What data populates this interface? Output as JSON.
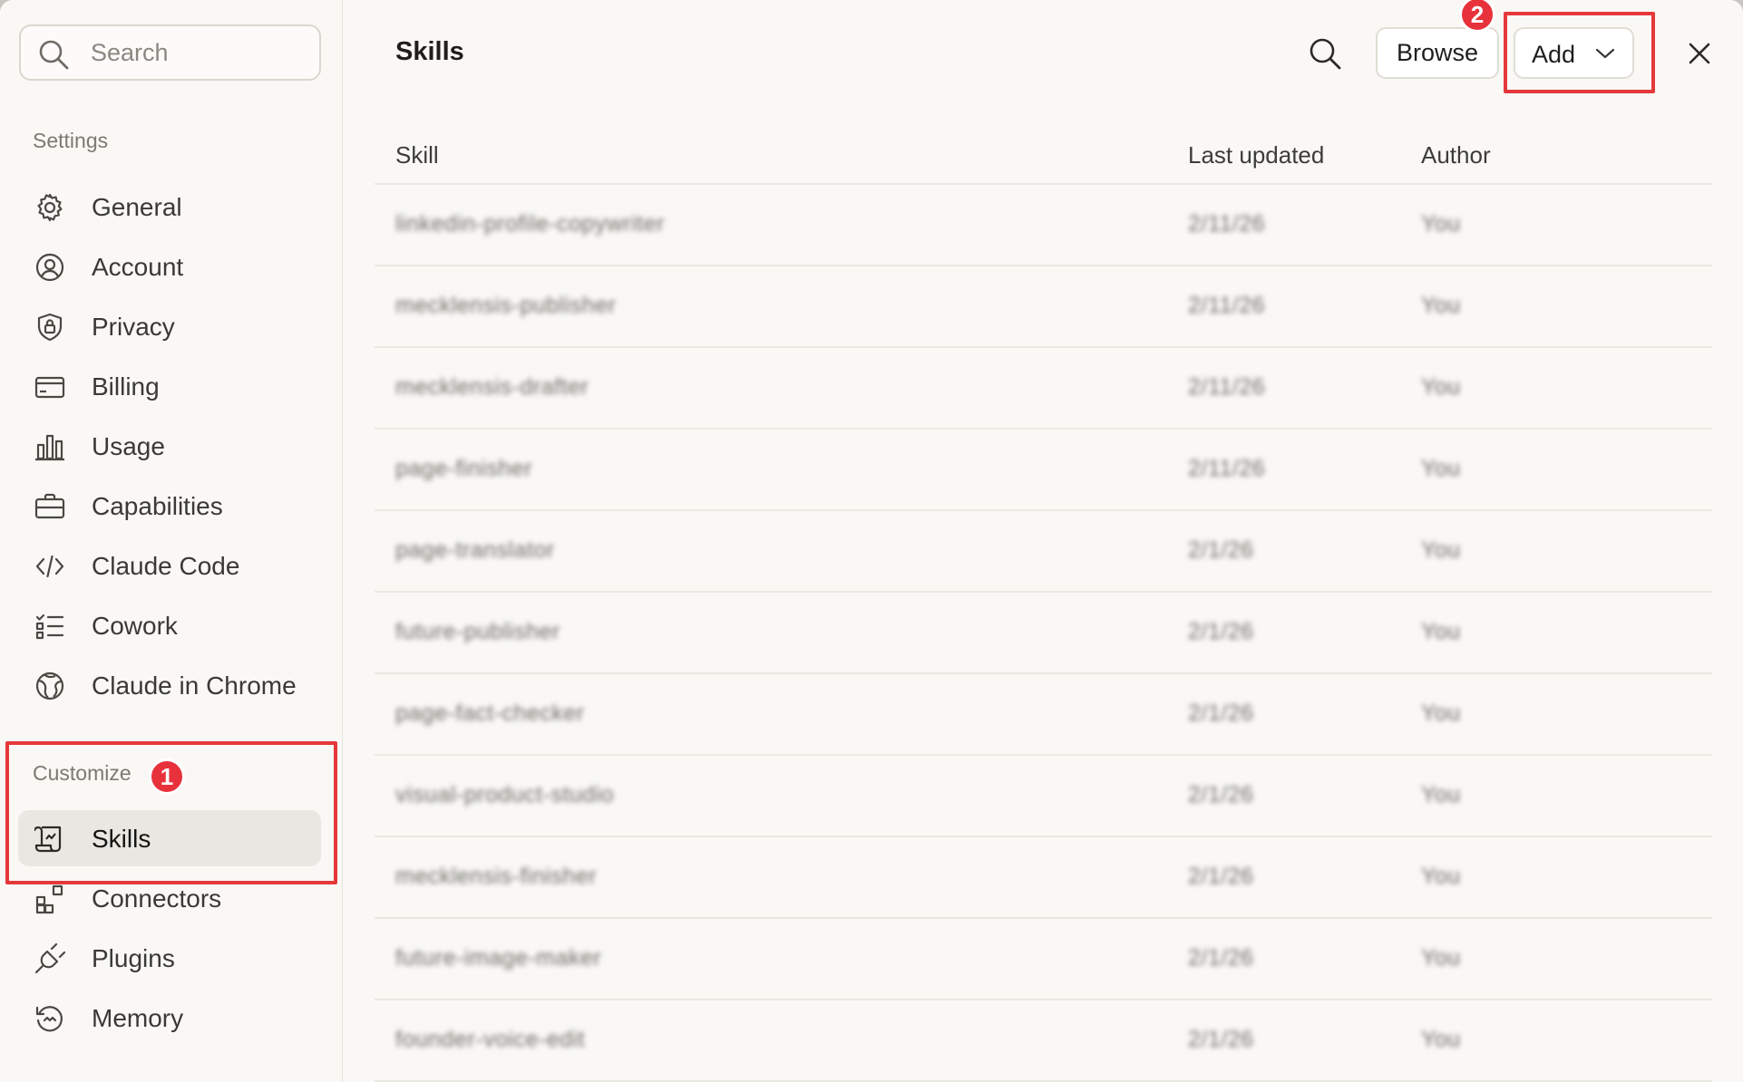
{
  "sidebar": {
    "search": {
      "placeholder": "Search",
      "value": ""
    },
    "settings_label": "Settings",
    "settings_items": [
      {
        "label": "General",
        "icon": "gear-icon"
      },
      {
        "label": "Account",
        "icon": "user-circle-icon"
      },
      {
        "label": "Privacy",
        "icon": "shield-lock-icon"
      },
      {
        "label": "Billing",
        "icon": "credit-card-icon"
      },
      {
        "label": "Usage",
        "icon": "bar-chart-icon"
      },
      {
        "label": "Capabilities",
        "icon": "briefcase-icon"
      },
      {
        "label": "Claude Code",
        "icon": "code-icon"
      },
      {
        "label": "Cowork",
        "icon": "checklist-icon"
      },
      {
        "label": "Claude in Chrome",
        "icon": "globe-icon"
      }
    ],
    "customize_label": "Customize",
    "customize_items": [
      {
        "label": "Skills",
        "icon": "scroll-icon",
        "active": true
      },
      {
        "label": "Connectors",
        "icon": "blocks-icon"
      },
      {
        "label": "Plugins",
        "icon": "plug-icon"
      },
      {
        "label": "Memory",
        "icon": "history-icon"
      }
    ]
  },
  "main": {
    "title": "Skills",
    "browse_label": "Browse",
    "add_label": "Add",
    "table": {
      "headers": {
        "skill": "Skill",
        "last_updated": "Last updated",
        "author": "Author"
      },
      "rows": [
        {
          "skill": "linkedin-profile-copywriter",
          "date": "2/11/26",
          "author": "You"
        },
        {
          "skill": "mecklensis-publisher",
          "date": "2/11/26",
          "author": "You"
        },
        {
          "skill": "mecklensis-drafter",
          "date": "2/11/26",
          "author": "You"
        },
        {
          "skill": "page-finisher",
          "date": "2/11/26",
          "author": "You"
        },
        {
          "skill": "page-translator",
          "date": "2/1/26",
          "author": "You"
        },
        {
          "skill": "future-publisher",
          "date": "2/1/26",
          "author": "You"
        },
        {
          "skill": "page-fact-checker",
          "date": "2/1/26",
          "author": "You"
        },
        {
          "skill": "visual-product-studio",
          "date": "2/1/26",
          "author": "You"
        },
        {
          "skill": "mecklensis-finisher",
          "date": "2/1/26",
          "author": "You"
        },
        {
          "skill": "future-image-maker",
          "date": "2/1/26",
          "author": "You"
        },
        {
          "skill": "founder-voice-edit",
          "date": "2/1/26",
          "author": "You"
        }
      ]
    }
  },
  "annotations": {
    "badge_1": "1",
    "badge_2": "2",
    "color": "#e5383b"
  },
  "colors": {
    "background": "#f9f8f5",
    "active_item": "#e9e7e1",
    "border": "#e6e3dc"
  }
}
